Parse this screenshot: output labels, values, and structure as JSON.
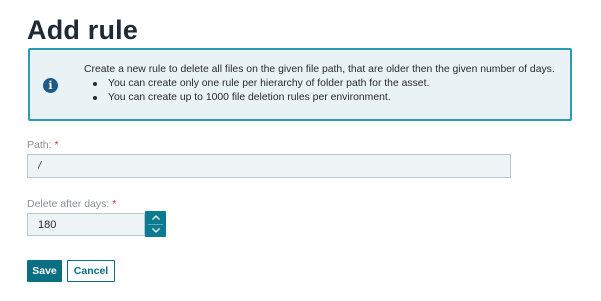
{
  "page": {
    "title": "Add rule"
  },
  "info": {
    "icon": "info-icon",
    "description": "Create a new rule to delete all files on the given file path, that are older then the given number of days.",
    "bullets": [
      "You can create only one rule per hierarchy of folder path for the asset.",
      "You can create up to 1000 file deletion rules per environment."
    ],
    "colors": {
      "border": "#2b9bb3",
      "background": "#e9f2f5",
      "icon": "#1d5a86"
    }
  },
  "form": {
    "path": {
      "label": "Path:",
      "required_marker": "*",
      "value": "/"
    },
    "days": {
      "label": "Delete after days:",
      "required_marker": "*",
      "value": "180"
    }
  },
  "actions": {
    "save_label": "Save",
    "cancel_label": "Cancel"
  },
  "colors": {
    "accent": "#0b6f84",
    "required": "#d0342c"
  }
}
